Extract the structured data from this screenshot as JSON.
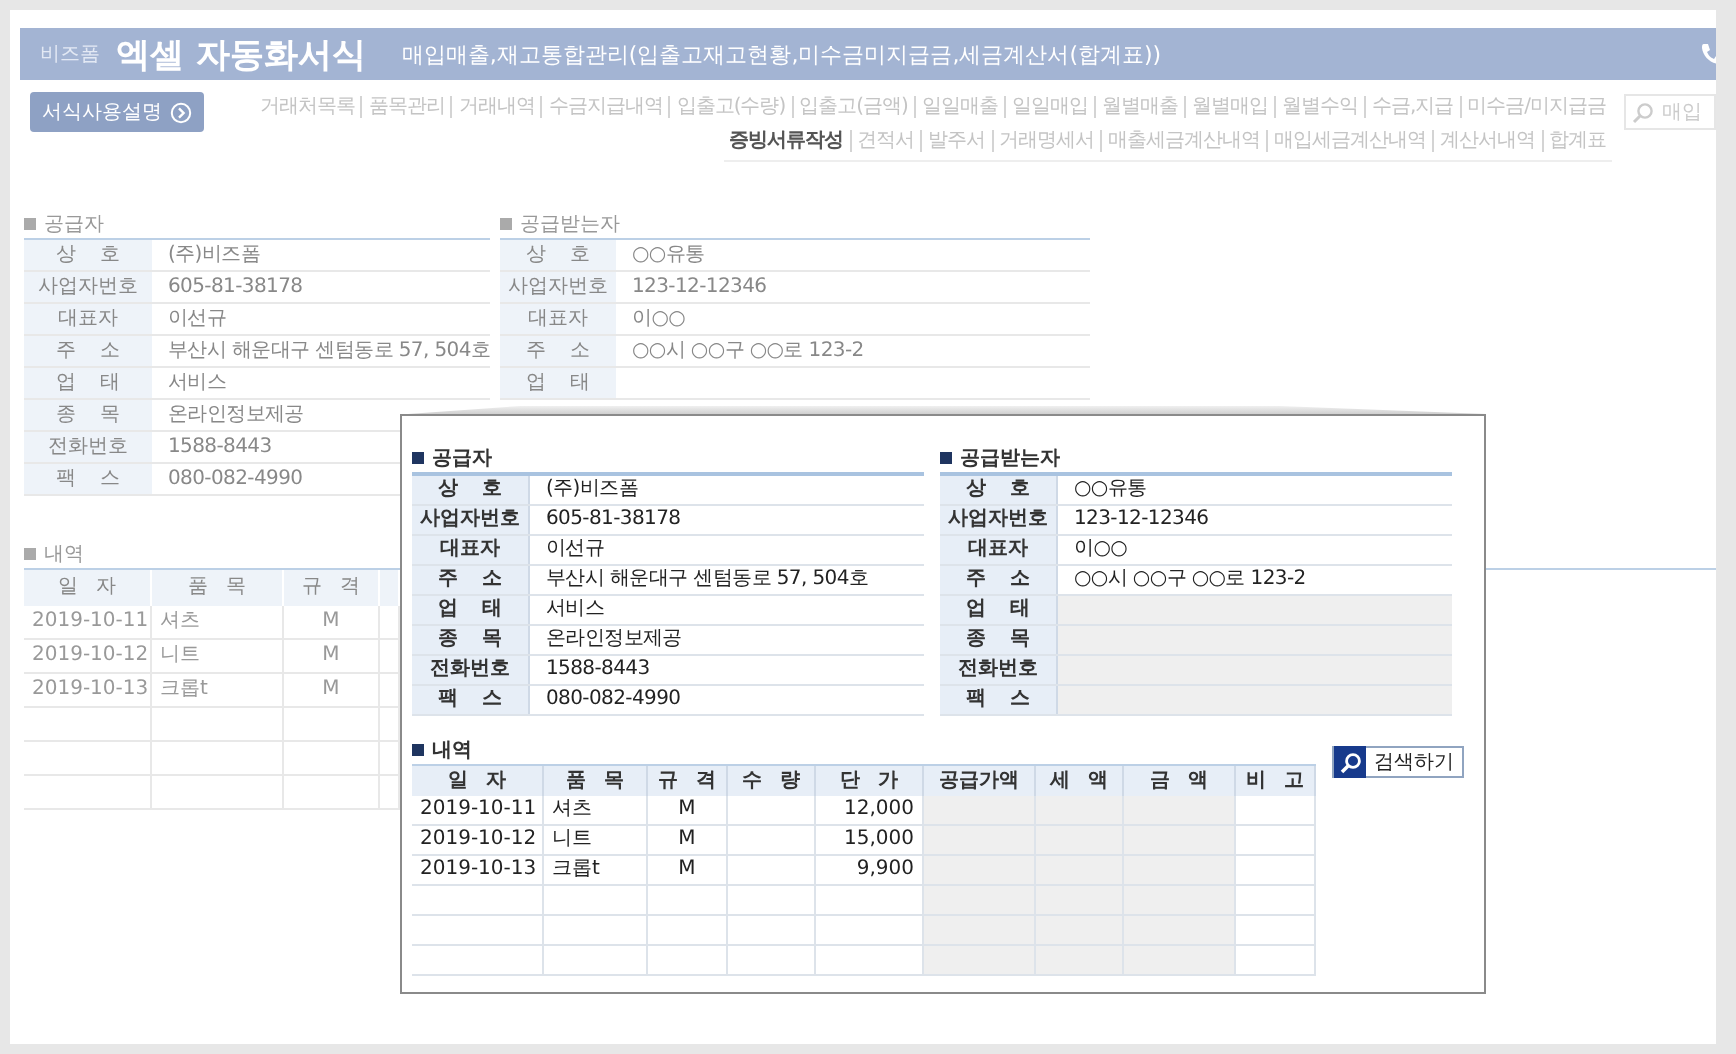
{
  "header": {
    "logo": "비즈폼",
    "title": "엑셀 자동화서식",
    "subtitle": "매입매출,재고통합관리(입출고재고현황,미수금미지급금,세금계산서(합계표))"
  },
  "help_button": {
    "label": "서식사용설명"
  },
  "nav_rows": [
    [
      {
        "label": "거래처목록",
        "selected": false
      },
      {
        "label": "품목관리",
        "selected": false
      },
      {
        "label": "거래내역",
        "selected": false
      },
      {
        "label": "수금지급내역",
        "selected": false
      },
      {
        "label": "입출고(수량)",
        "selected": false
      },
      {
        "label": "입출고(금액)",
        "selected": false
      },
      {
        "label": "일일매출",
        "selected": false
      },
      {
        "label": "일일매입",
        "selected": false
      },
      {
        "label": "월별매출",
        "selected": false
      },
      {
        "label": "월별매입",
        "selected": false
      },
      {
        "label": "월별수익",
        "selected": false
      },
      {
        "label": "수금,지급",
        "selected": false
      },
      {
        "label": "미수금/미지급금",
        "selected": false
      }
    ],
    [
      {
        "label": "증빙서류작성",
        "selected": true
      },
      {
        "label": "견적서",
        "selected": false
      },
      {
        "label": "발주서",
        "selected": false
      },
      {
        "label": "거래명세서",
        "selected": false
      },
      {
        "label": "매출세금계산내역",
        "selected": false
      },
      {
        "label": "매입세금계산내역",
        "selected": false
      },
      {
        "label": "계산서내역",
        "selected": false
      },
      {
        "label": "합계표",
        "selected": false
      }
    ]
  ],
  "search": {
    "placeholder": "매입"
  },
  "page": {
    "supplier": {
      "title": "공급자",
      "rows": [
        {
          "label": "상 호",
          "value": "(주)비즈폼"
        },
        {
          "label": "사업자번호",
          "value": "605-81-38178"
        },
        {
          "label": "대표자",
          "value": "이선규"
        },
        {
          "label": "주 소",
          "value": "부산시 해운대구 센텀동로 57, 504호"
        },
        {
          "label": "업 태",
          "value": "서비스"
        },
        {
          "label": "종 목",
          "value": "온라인정보제공"
        },
        {
          "label": "전화번호",
          "value": "1588-8443"
        },
        {
          "label": "팩 스",
          "value": "080-082-4990"
        }
      ]
    },
    "recipient": {
      "title": "공급받는자",
      "rows": [
        {
          "label": "상 호",
          "value": "○○유통"
        },
        {
          "label": "사업자번호",
          "value": "123-12-12346"
        },
        {
          "label": "대표자",
          "value": "이○○"
        },
        {
          "label": "주 소",
          "value": "○○시 ○○구 ○○로 123-2"
        },
        {
          "label": "업 태"
        }
      ]
    },
    "details": {
      "title": "내역",
      "columns": [
        {
          "label": "일 자"
        },
        {
          "label": "품 목"
        },
        {
          "label": "규 격"
        }
      ],
      "rows": [
        {
          "date": "2019-10-11",
          "item": "셔츠",
          "spec": "M"
        },
        {
          "date": "2019-10-12",
          "item": "니트",
          "spec": "M"
        },
        {
          "date": "2019-10-13",
          "item": "크롭t",
          "spec": "M"
        }
      ]
    }
  },
  "popup": {
    "supplier": {
      "title": "공급자",
      "rows": [
        {
          "label": "상 호",
          "value": "(주)비즈폼"
        },
        {
          "label": "사업자번호",
          "value": "605-81-38178"
        },
        {
          "label": "대표자",
          "value": "이선규"
        },
        {
          "label": "주 소",
          "value": "부산시 해운대구 센텀동로 57, 504호"
        },
        {
          "label": "업 태",
          "value": "서비스"
        },
        {
          "label": "종 목",
          "value": "온라인정보제공"
        },
        {
          "label": "전화번호",
          "value": "1588-8443"
        },
        {
          "label": "팩 스",
          "value": "080-082-4990"
        }
      ]
    },
    "recipient": {
      "title": "공급받는자",
      "rows": [
        {
          "label": "상 호",
          "value": "○○유통"
        },
        {
          "label": "사업자번호",
          "value": "123-12-12346"
        },
        {
          "label": "대표자",
          "value": "이○○"
        },
        {
          "label": "주 소",
          "value": "○○시 ○○구 ○○로 123-2"
        },
        {
          "label": "업 태"
        },
        {
          "label": "종 목"
        },
        {
          "label": "전화번호"
        },
        {
          "label": "팩 스"
        }
      ]
    },
    "details": {
      "title": "내역",
      "columns": [
        {
          "label": "일 자",
          "kind": "input"
        },
        {
          "label": "품 목",
          "kind": "input"
        },
        {
          "label": "규 격",
          "kind": "input"
        },
        {
          "label": "수 량",
          "kind": "input"
        },
        {
          "label": "단 가",
          "kind": "input"
        },
        {
          "label": "공급가액",
          "kind": "computed"
        },
        {
          "label": "세 액",
          "kind": "computed"
        },
        {
          "label": "금 액",
          "kind": "computed"
        },
        {
          "label": "비 고",
          "kind": "input"
        }
      ],
      "rows": [
        {
          "date": "2019-10-11",
          "item": "셔츠",
          "spec": "M",
          "unit_price": "12,000"
        },
        {
          "date": "2019-10-12",
          "item": "니트",
          "spec": "M",
          "unit_price": "15,000"
        },
        {
          "date": "2019-10-13",
          "item": "크롭t",
          "spec": "M",
          "unit_price": "9,900"
        }
      ]
    },
    "search_button": {
      "label": "검색하기"
    }
  }
}
